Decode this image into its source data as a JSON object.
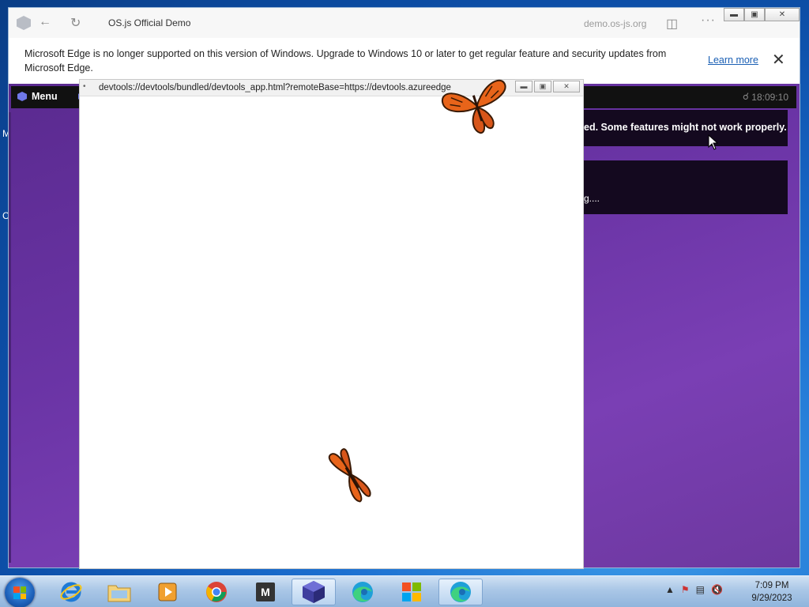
{
  "browser": {
    "tab_title": "OS.js Official Demo",
    "url_host": "demo.os-js.org",
    "more_label": "···",
    "infobar": {
      "message": "Microsoft Edge is no longer supported on this version of Windows. Upgrade to Windows 10 or later to get regular feature and security updates from Microsoft Edge.",
      "learn_more": "Learn more",
      "close": "✕"
    }
  },
  "osjs": {
    "menu_label": "Menu",
    "clock": "18:09:10",
    "notification1": "ed. Some features might not work properly.",
    "notification2": "g...."
  },
  "devtools": {
    "bullet": "•",
    "url": "devtools://devtools/bundled/devtools_app.html?remoteBase=https://devtools.azureedge"
  },
  "taskbar": {
    "active_app": "edge-icon",
    "time": "7:09 PM",
    "date": "9/29/2023",
    "m_app_letter": "M"
  },
  "desktop": {
    "ghost_letters": [
      "M",
      "C"
    ]
  },
  "colors": {
    "osjs_purple": "#6a34a5",
    "butterfly_orange": "#e8641a"
  }
}
